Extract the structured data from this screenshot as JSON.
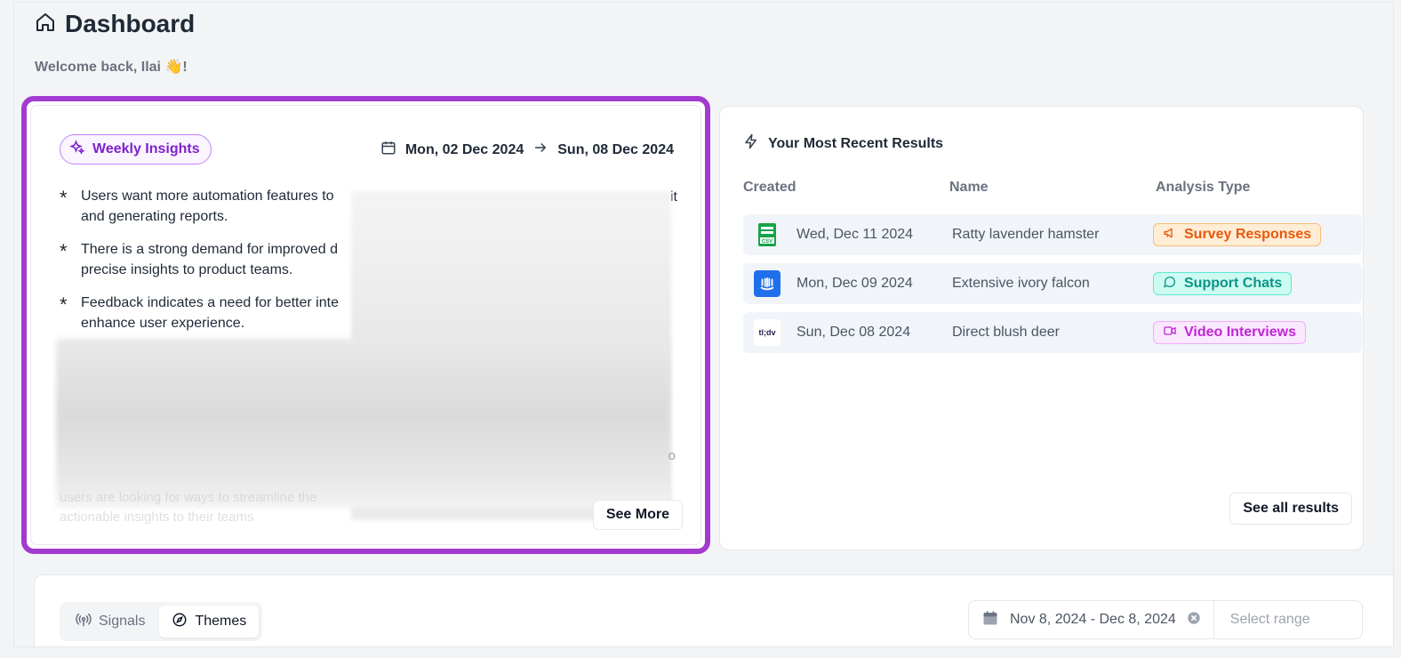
{
  "header": {
    "title": "Dashboard",
    "welcome": "Welcome back, Ilai 👋!"
  },
  "insights": {
    "pill_label": "Weekly Insights",
    "date_start": "Mon, 02 Dec 2024",
    "date_end": "Sun, 08 Dec 2024",
    "bullets": [
      "Users want more automation features to and generating reports.",
      "There is a strong demand for improved d precise insights to product teams.",
      "Feedback indicates a need for better inte enhance user experience."
    ],
    "bullet_lines": [
      [
        "Users want more automation features to",
        "and generating reports."
      ],
      [
        "There is a strong demand for improved d",
        "precise insights to product teams."
      ],
      [
        "Feedback indicates a need for better inte",
        "enhance user experience."
      ]
    ],
    "stray_right_1": "it",
    "stray_right_2": "o",
    "faded_text": "users are looking for ways to streamline the actionable insights to their teams",
    "see_more_label": "See More"
  },
  "results": {
    "title": "Your Most Recent Results",
    "columns": [
      "Created",
      "Name",
      "Analysis Type"
    ],
    "rows": [
      {
        "source": "CSV",
        "created": "Wed, Dec 11 2024",
        "name": "Ratty lavender hamster",
        "type": "Survey Responses",
        "color": "#ea580c"
      },
      {
        "source": "Intercom",
        "created": "Mon, Dec 09 2024",
        "name": "Extensive ivory falcon",
        "type": "Support Chats",
        "color": "#0d9488"
      },
      {
        "source": "tl;dv",
        "created": "Sun, Dec 08 2024",
        "name": "Direct blush deer",
        "type": "Video Interviews",
        "color": "#c026d3"
      }
    ],
    "see_all_label": "See all results"
  },
  "bottom": {
    "tabs": [
      "Signals",
      "Themes"
    ],
    "active_tab": "Themes",
    "date_range": "Nov 8, 2024 - Dec 8, 2024",
    "select_range": "Select range"
  },
  "colors": {
    "highlight": "#a33ad0",
    "accent_purple": "#7e22ce"
  }
}
